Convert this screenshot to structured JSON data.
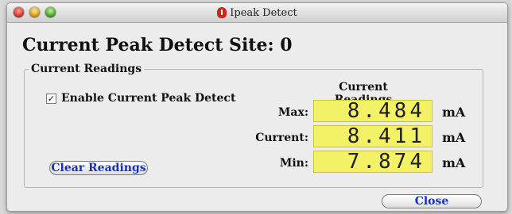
{
  "window": {
    "title": "Ipeak Detect"
  },
  "site_title": "Current Peak Detect Site: 0",
  "group": {
    "legend": "Current Readings",
    "checkbox": {
      "label": "Enable Current Peak Detect",
      "checked": true,
      "glyph": "✓"
    },
    "readings_header": "Current Readings",
    "readings": [
      {
        "label": "Max:",
        "value": "8.484",
        "unit": "mA"
      },
      {
        "label": "Current:",
        "value": "8.411",
        "unit": "mA"
      },
      {
        "label": "Min:",
        "value": "7.874",
        "unit": "mA"
      }
    ],
    "clear_button": "Clear Readings"
  },
  "close_button": "Close",
  "colors": {
    "lcd_background": "#f3f165",
    "button_text": "#1830c0"
  }
}
